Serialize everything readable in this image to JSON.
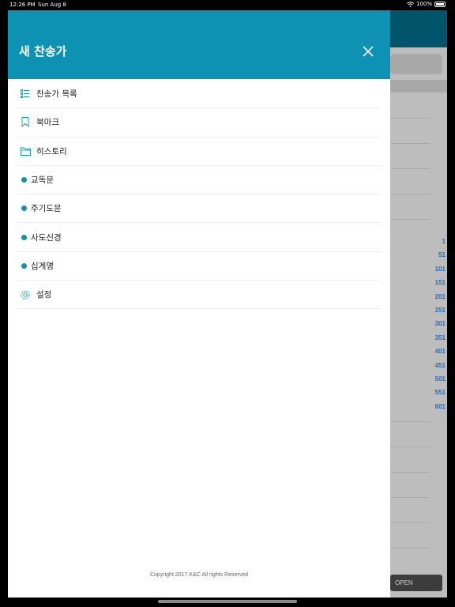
{
  "status_bar": {
    "time": "12:26 PM",
    "date": "Sun Aug 8",
    "battery": "100%",
    "icons": [
      "wifi-icon",
      "battery-icon"
    ]
  },
  "drawer": {
    "title": "새 찬송가",
    "close_icon": "close-icon",
    "items": [
      {
        "label": "찬송가 목록",
        "icon": "list-icon"
      },
      {
        "label": "북마크",
        "icon": "bookmark-icon"
      },
      {
        "label": "히스토리",
        "icon": "folder-icon"
      },
      {
        "label": "교독문",
        "icon": "dot"
      },
      {
        "label": "주기도문",
        "icon": "dot"
      },
      {
        "label": "사도신경",
        "icon": "dot"
      },
      {
        "label": "십계명",
        "icon": "dot"
      },
      {
        "label": "설정",
        "icon": "gear-icon"
      }
    ],
    "copyright": "Copyright.2017.K&C All rights Reserved"
  },
  "background": {
    "hymn_numbers": [
      "1",
      "51",
      "101",
      "151",
      "201",
      "251",
      "301",
      "351",
      "401",
      "451",
      "501",
      "551",
      "601"
    ],
    "open_button": "OPEN"
  },
  "colors": {
    "accent": "#0e92b3",
    "dimmed_header": "#00556a",
    "number_link": "#2c69b0"
  }
}
